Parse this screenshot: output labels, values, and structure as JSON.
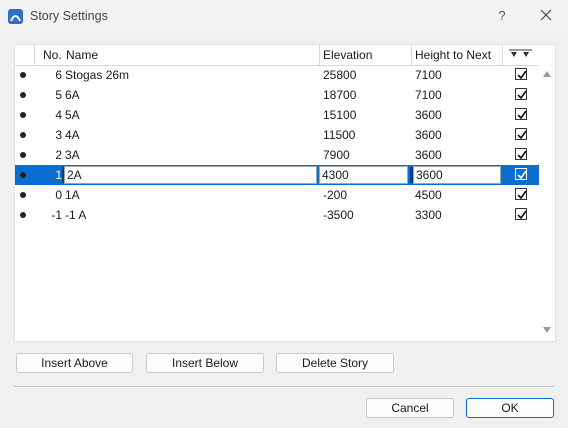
{
  "window": {
    "title": "Story Settings",
    "help_label": "?"
  },
  "table": {
    "columns": {
      "no": "No.",
      "name": "Name",
      "elevation": "Elevation",
      "height_to_next": "Height to Next"
    },
    "rows": [
      {
        "no": "6",
        "name": "Stogas 26m",
        "elevation": "25800",
        "height_to_next": "7100",
        "show": true
      },
      {
        "no": "5",
        "name": "6A",
        "elevation": "18700",
        "height_to_next": "7100",
        "show": true
      },
      {
        "no": "4",
        "name": "5A",
        "elevation": "15100",
        "height_to_next": "3600",
        "show": true
      },
      {
        "no": "3",
        "name": "4A",
        "elevation": "11500",
        "height_to_next": "3600",
        "show": true
      },
      {
        "no": "2",
        "name": "3A",
        "elevation": "7900",
        "height_to_next": "3600",
        "show": true
      },
      {
        "no": "1",
        "name": "2A",
        "elevation": "4300",
        "height_to_next": "3600",
        "show": true,
        "selected": true
      },
      {
        "no": "0",
        "name": "1A",
        "elevation": "-200",
        "height_to_next": "4500",
        "show": true
      },
      {
        "no": "-1",
        "name": "-1 A",
        "elevation": "-3500",
        "height_to_next": "3300",
        "show": true
      }
    ]
  },
  "buttons": {
    "insert_above": "Insert Above",
    "insert_below": "Insert Below",
    "delete_story": "Delete Story",
    "cancel": "Cancel",
    "ok": "OK"
  },
  "colors": {
    "selection": "#0a6dd0",
    "accent": "#0a6dd0"
  }
}
